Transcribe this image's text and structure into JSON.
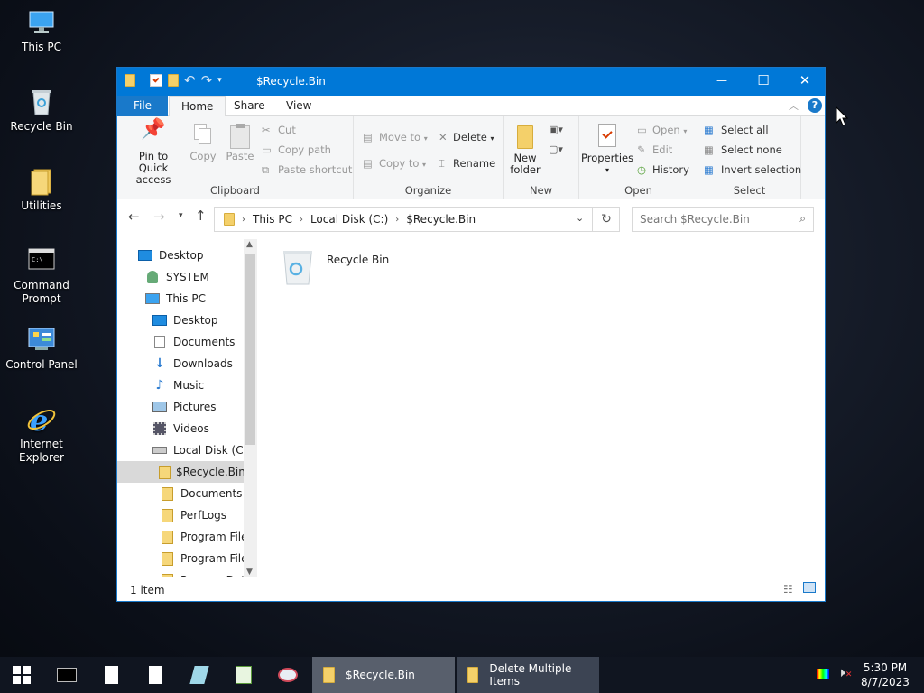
{
  "desktop": {
    "icons": [
      {
        "label": "This PC",
        "icon": "computer-icon"
      },
      {
        "label": "Recycle Bin",
        "icon": "recycle-bin-icon"
      },
      {
        "label": "Utilities",
        "icon": "folder-icon"
      },
      {
        "label": "Command Prompt",
        "icon": "cmd-icon"
      },
      {
        "label": "Control Panel",
        "icon": "control-panel-icon"
      },
      {
        "label": "Internet Explorer",
        "icon": "ie-icon"
      }
    ]
  },
  "window": {
    "title": "$Recycle.Bin",
    "controls": {
      "minimize": "—",
      "maximize": "☐",
      "close": "✕"
    },
    "accent": "#0078d7"
  },
  "menu": {
    "file": "File",
    "home": "Home",
    "share": "Share",
    "view": "View"
  },
  "ribbon": {
    "clipboard": {
      "label": "Clipboard",
      "pin": "Pin to Quick access",
      "copy": "Copy",
      "paste": "Paste",
      "cut": "Cut",
      "copy_path": "Copy path",
      "paste_shortcut": "Paste shortcut"
    },
    "organize": {
      "label": "Organize",
      "move_to": "Move to",
      "copy_to": "Copy to",
      "delete": "Delete",
      "rename": "Rename"
    },
    "new": {
      "label": "New",
      "new_folder": "New folder"
    },
    "open": {
      "label": "Open",
      "properties": "Properties",
      "open": "Open",
      "edit": "Edit",
      "history": "History"
    },
    "select": {
      "label": "Select",
      "select_all": "Select all",
      "select_none": "Select none",
      "invert": "Invert selection"
    }
  },
  "address": {
    "crumbs": [
      "This PC",
      "Local Disk (C:)",
      "$Recycle.Bin"
    ],
    "search_placeholder": "Search $Recycle.Bin"
  },
  "tree": [
    {
      "label": "Desktop",
      "icon": "desktop-icon"
    },
    {
      "label": "SYSTEM",
      "icon": "user-icon"
    },
    {
      "label": "This PC",
      "icon": "computer-icon"
    },
    {
      "label": "Desktop",
      "icon": "desktop-icon"
    },
    {
      "label": "Documents",
      "icon": "documents-icon"
    },
    {
      "label": "Downloads",
      "icon": "downloads-icon"
    },
    {
      "label": "Music",
      "icon": "music-icon"
    },
    {
      "label": "Pictures",
      "icon": "pictures-icon"
    },
    {
      "label": "Videos",
      "icon": "videos-icon"
    },
    {
      "label": "Local Disk (C:)",
      "icon": "drive-icon"
    },
    {
      "label": "$Recycle.Bin",
      "icon": "folder-icon"
    },
    {
      "label": "Documents a",
      "icon": "folder-icon"
    },
    {
      "label": "PerfLogs",
      "icon": "folder-icon"
    },
    {
      "label": "Program Files",
      "icon": "folder-icon"
    },
    {
      "label": "Program Files",
      "icon": "folder-icon"
    },
    {
      "label": "ProgramData",
      "icon": "folder-icon"
    }
  ],
  "content": {
    "items": [
      {
        "label": "Recycle Bin",
        "icon": "recycle-bin-icon"
      }
    ]
  },
  "status": {
    "count": "1 item"
  },
  "taskbar": {
    "open_windows": [
      "$Recycle.Bin",
      "Delete Multiple Items"
    ],
    "time": "5:30 PM",
    "date": "8/7/2023"
  }
}
